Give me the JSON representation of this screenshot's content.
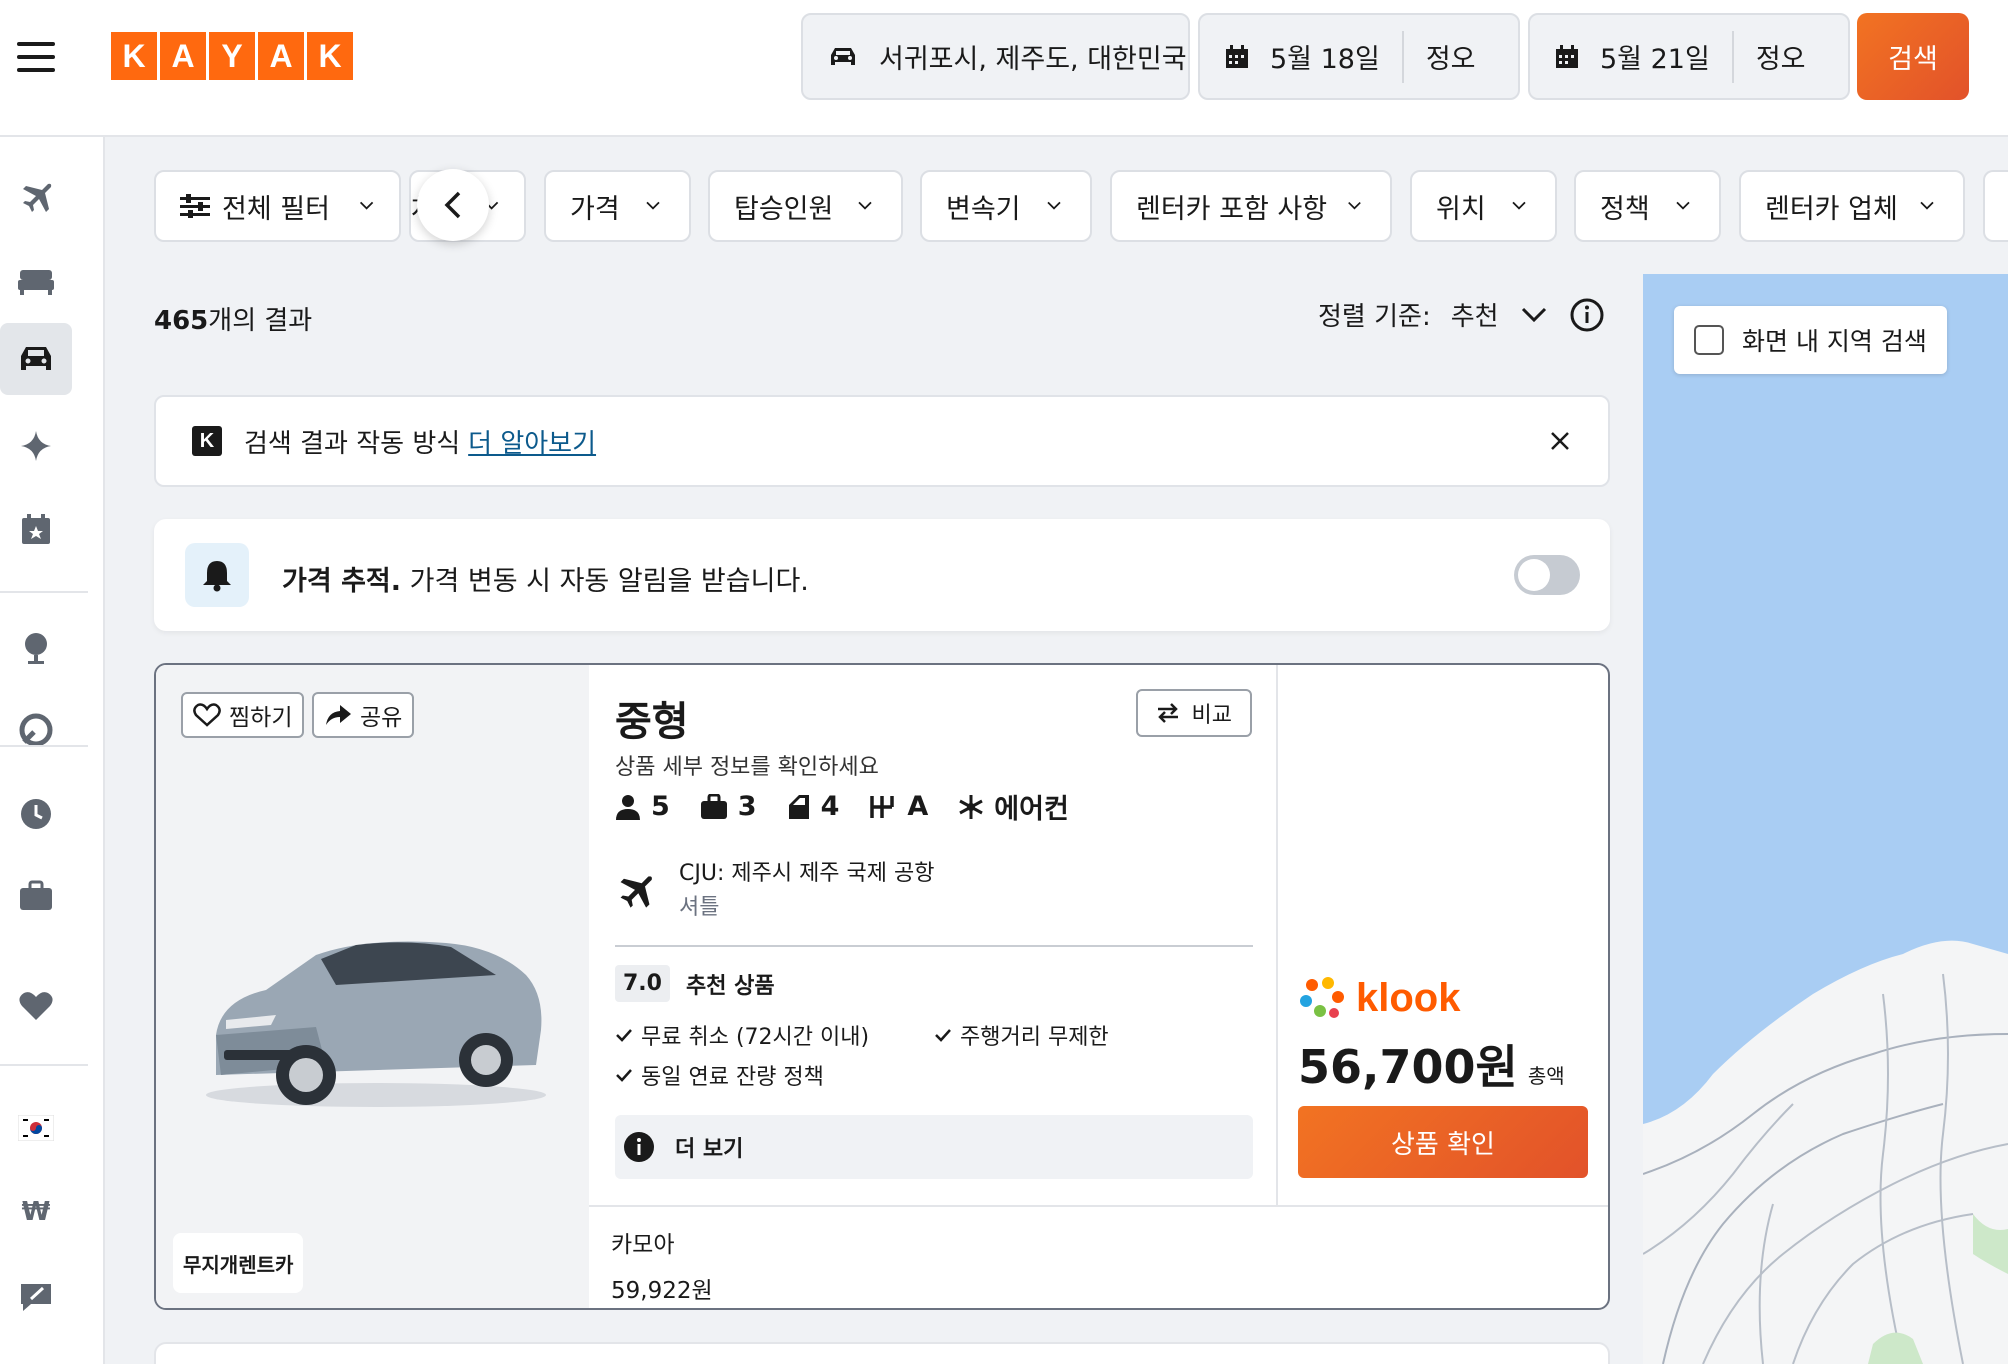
{
  "header": {
    "logo_letters": [
      "K",
      "A",
      "Y",
      "A",
      "K"
    ],
    "location": "서귀포시, 제주도, 대한민국",
    "pickup_date": "5월 18일",
    "pickup_time": "정오",
    "dropoff_date": "5월 21일",
    "dropoff_time": "정오",
    "search_label": "검색",
    "brand_color": "#ff690f"
  },
  "sidebar": {
    "items": [
      "plane-icon",
      "bed-icon",
      "car-icon",
      "sparkle-icon",
      "calendar-star-icon",
      "globe-icon",
      "trips-icon",
      "clock-icon",
      "briefcase-icon",
      "heart-icon",
      "korea-flag-icon",
      "won-icon",
      "feedback-icon"
    ]
  },
  "filters": {
    "all_filters": "전체 필터",
    "partial": "차",
    "price": "가격",
    "passengers": "탑승인원",
    "transmission": "변속기",
    "included": "렌터카 포함 사항",
    "location": "위치",
    "policy": "정책",
    "agency": "렌터카 업체"
  },
  "results": {
    "count_number": "465",
    "count_suffix": "개의 결과",
    "sort_label": "정렬 기준:",
    "sort_value": "추천"
  },
  "banner": {
    "text": "검색 결과 작동 방식",
    "link": "더 알아보기"
  },
  "price_alert": {
    "bold": "가격 추적.",
    "text": "가격 변동 시 자동 알림을 받습니다."
  },
  "card": {
    "save": "찜하기",
    "share": "공유",
    "vendor": "무지개렌트카",
    "title": "중형",
    "subtitle": "상품 세부 정보를 확인하세요",
    "compare": "비교",
    "specs": {
      "passengers": "5",
      "bags": "3",
      "doors": "4",
      "transmission": "A",
      "aircon": "에어컨"
    },
    "pickup_location": "CJU: 제주시 제주 국제 공항",
    "pickup_type": "셔틀",
    "score": "7.0",
    "score_label": "추천 상품",
    "features": [
      "무료 취소 (72시간 이내)",
      "주행거리 무제한",
      "동일 연료 잔량 정책"
    ],
    "more": "더 보기",
    "provider": "klook",
    "price": "56,700원",
    "price_suffix": "총액",
    "cta": "상품 확인",
    "alt_provider": "카모아",
    "alt_price": "59,922원"
  },
  "map": {
    "search_area": "화면 내 지역 검색"
  }
}
